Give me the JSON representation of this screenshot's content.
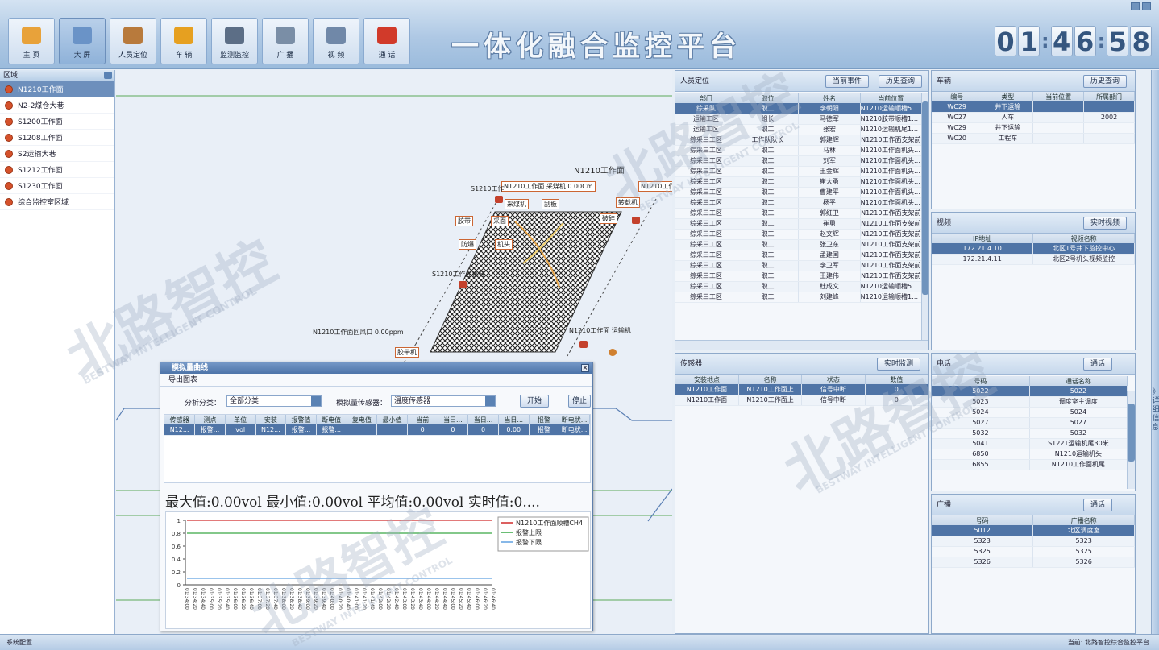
{
  "app": {
    "title": "一体化融合监控平台"
  },
  "clock": {
    "h": "01",
    "m": "46",
    "s": "58"
  },
  "nav": [
    {
      "label": "主 页",
      "icon": "home-icon",
      "active": false
    },
    {
      "label": "大 屏",
      "icon": "screen-icon",
      "active": true
    },
    {
      "label": "人员定位",
      "icon": "people-location-icon",
      "active": false
    },
    {
      "label": "车 辆",
      "icon": "vehicle-icon",
      "active": false
    },
    {
      "label": "监测监控",
      "icon": "monitor-icon",
      "active": false
    },
    {
      "label": "广 播",
      "icon": "broadcast-icon",
      "active": false
    },
    {
      "label": "视 频",
      "icon": "camera-icon",
      "active": false
    },
    {
      "label": "通 话",
      "icon": "phone-icon",
      "active": false
    }
  ],
  "tree": {
    "title": "区域",
    "items": [
      "N1210工作面",
      "N2-2煤仓大巷",
      "S1200工作面",
      "S1208工作面",
      "S2运输大巷",
      "S1212工作面",
      "S1230工作面",
      "综合监控室区域"
    ]
  },
  "map": {
    "title": "N1210工作面",
    "labels": [
      "N1210工作面 采煤机 0.00Cm",
      "S1210工作",
      "采煤机",
      "刮板",
      "胶带",
      "采面",
      "防爆",
      "机头",
      "转载机",
      "破碎",
      "S1210工作面机巷",
      "N1210工作面回风口 0.00ppm",
      "N1210工作面",
      "胶带机",
      "N1210工作面 运输机"
    ]
  },
  "staff": {
    "title": "人员定位",
    "btn_a": "当前事件",
    "btn_b": "历史查询",
    "columns": [
      "部门",
      "职位",
      "姓名",
      "当前位置"
    ],
    "rows": [
      [
        "综采队",
        "职工",
        "李朝阳",
        "N1210运输顺槽50米"
      ],
      [
        "运输工区",
        "组长",
        "马德军",
        "N1210胶带顺槽150米"
      ],
      [
        "运输工区",
        "职工",
        "张宏",
        "N1210运输机尾15米"
      ],
      [
        "综采三工区",
        "工作队队长",
        "郭建辉",
        "N1210工作面支架前"
      ],
      [
        "综采三工区",
        "职工",
        "马林",
        "N1210工作面机头150米"
      ],
      [
        "综采三工区",
        "职工",
        "刘军",
        "N1210工作面机头130米"
      ],
      [
        "综采三工区",
        "职工",
        "王金辉",
        "N1210工作面机头15米"
      ],
      [
        "综采三工区",
        "职工",
        "崔大勇",
        "N1210工作面机头15米"
      ],
      [
        "综采三工区",
        "职工",
        "曹建平",
        "N1210工作面机头135米"
      ],
      [
        "综采三工区",
        "职工",
        "杨平",
        "N1210工作面机头130米"
      ],
      [
        "综采三工区",
        "职工",
        "郭红卫",
        "N1210工作面支架前"
      ],
      [
        "综采三工区",
        "职工",
        "崔勇",
        "N1210工作面支架前"
      ],
      [
        "综采三工区",
        "职工",
        "赵文辉",
        "N1210工作面支架前"
      ],
      [
        "综采三工区",
        "职工",
        "张卫东",
        "N1210工作面支架前"
      ],
      [
        "综采三工区",
        "职工",
        "孟建国",
        "N1210工作面支架前"
      ],
      [
        "综采三工区",
        "职工",
        "李卫军",
        "N1210工作面支架前"
      ],
      [
        "综采三工区",
        "职工",
        "王建伟",
        "N1210工作面支架前"
      ],
      [
        "综采三工区",
        "职工",
        "杜成文",
        "N1210运输顺槽50米"
      ],
      [
        "综采三工区",
        "职工",
        "刘建峰",
        "N1210运输顺槽150米"
      ]
    ]
  },
  "vehicle": {
    "title": "车辆",
    "btn": "历史查询",
    "columns": [
      "编号",
      "类型",
      "当前位置",
      "所属部门"
    ],
    "rows": [
      [
        "WC29",
        "井下运输",
        "",
        ""
      ],
      [
        "WC27",
        "人车",
        "",
        "2002"
      ],
      [
        "WC29",
        "井下运输",
        "",
        ""
      ],
      [
        "WC20",
        "工程车",
        "",
        ""
      ]
    ]
  },
  "video": {
    "title": "视频",
    "btn": "实时视频",
    "columns": [
      "IP地址",
      "视频名称"
    ],
    "rows": [
      [
        "172.21.4.10",
        "北区1号井下监控中心"
      ],
      [
        "172.21.4.11",
        "北区2号机头视频监控"
      ]
    ]
  },
  "sensor": {
    "title": "传感器",
    "btn": "实时监测",
    "columns": [
      "安装地点",
      "名称",
      "状态",
      "数值"
    ],
    "rows": [
      [
        "N1210工作面",
        "N1210工作面上",
        "信号中断",
        "0"
      ],
      [
        "N1210工作面",
        "N1210工作面上",
        "信号中断",
        "0"
      ]
    ]
  },
  "phone": {
    "title": "电话",
    "btn": "通话",
    "columns": [
      "号码",
      "通话名称"
    ],
    "rows": [
      [
        "5022",
        "5022"
      ],
      [
        "5023",
        "调度室主调度"
      ],
      [
        "5024",
        "5024"
      ],
      [
        "5027",
        "5027"
      ],
      [
        "5032",
        "5032"
      ],
      [
        "5041",
        "S1221运输机尾30米"
      ],
      [
        "6850",
        "N1210运输机头"
      ],
      [
        "6855",
        "N1210工作面机尾"
      ]
    ]
  },
  "broadcast": {
    "title": "广播",
    "btn": "通话",
    "columns": [
      "号码",
      "广播名称"
    ],
    "rows": [
      [
        "5012",
        "北区调度室"
      ],
      [
        "5323",
        "5323"
      ],
      [
        "5325",
        "5325"
      ],
      [
        "5326",
        "5326"
      ]
    ]
  },
  "sidebar": {
    "label": "》详细信息》"
  },
  "dialog": {
    "title": "模拟量曲线",
    "menu": "导出图表",
    "f1_label": "分析分类：",
    "f1_value": "全部分类",
    "f2_label": "模拟量传感器：",
    "f2_value": "温度传感器",
    "btn_start": "开始",
    "btn_stop": "停止",
    "columns": [
      "传感器",
      "测点",
      "单位",
      "安装",
      "报警值",
      "断电值",
      "复电值",
      "最小值",
      "当前",
      "当日...",
      "当日...",
      "当日...",
      "报警",
      "断电状..."
    ],
    "row": [
      "N12...",
      "报警...",
      "vol",
      "N12...",
      "报警...",
      "报警...",
      "",
      "",
      "0",
      "0",
      "0",
      "0.00",
      "报警",
      "断电状..."
    ],
    "stats": "最大值:0.00vol   最小值:0.00vol   平均值:0.00vol   实时值:0....",
    "legend": [
      "N1210工作面顺槽CH4",
      "报警上限",
      "报警下限"
    ]
  },
  "chart_data": {
    "type": "line",
    "ylim": [
      0,
      1
    ],
    "yticks": [
      "1",
      "0.8",
      "0.6",
      "0.4",
      "0.2",
      "0"
    ],
    "x": [
      "01:34:00",
      "01:34:20",
      "01:34:40",
      "01:35:00",
      "01:35:20",
      "01:35:40",
      "01:36:00",
      "01:36:20",
      "01:36:40",
      "01:37:00",
      "01:37:20",
      "01:37:40",
      "01:38:00",
      "01:38:20",
      "01:38:40",
      "01:39:00",
      "01:39:20",
      "01:39:40",
      "01:40:00",
      "01:40:20",
      "01:40:40",
      "01:41:00",
      "01:41:20",
      "01:41:40",
      "01:42:00",
      "01:42:20",
      "01:42:40",
      "01:43:00",
      "01:43:20",
      "01:43:40",
      "01:44:00",
      "01:44:20",
      "01:44:40",
      "01:45:00",
      "01:45:20",
      "01:45:40",
      "01:46:00",
      "01:46:20",
      "01:46:40"
    ],
    "series": [
      {
        "name": "N1210工作面顺槽CH4",
        "color": "#d02a2a",
        "y": 1.0
      },
      {
        "name": "报警上限",
        "color": "#39a845",
        "y": 0.8
      },
      {
        "name": "报警下限",
        "color": "#5fa0e0",
        "y": 0.1
      }
    ]
  },
  "status": {
    "left": "系统配置",
    "right": "当前: 北路智控综合监控平台"
  },
  "watermark": {
    "cn": "北路智控",
    "en": "BESTWAY INTELLIGENT CONTROL"
  }
}
